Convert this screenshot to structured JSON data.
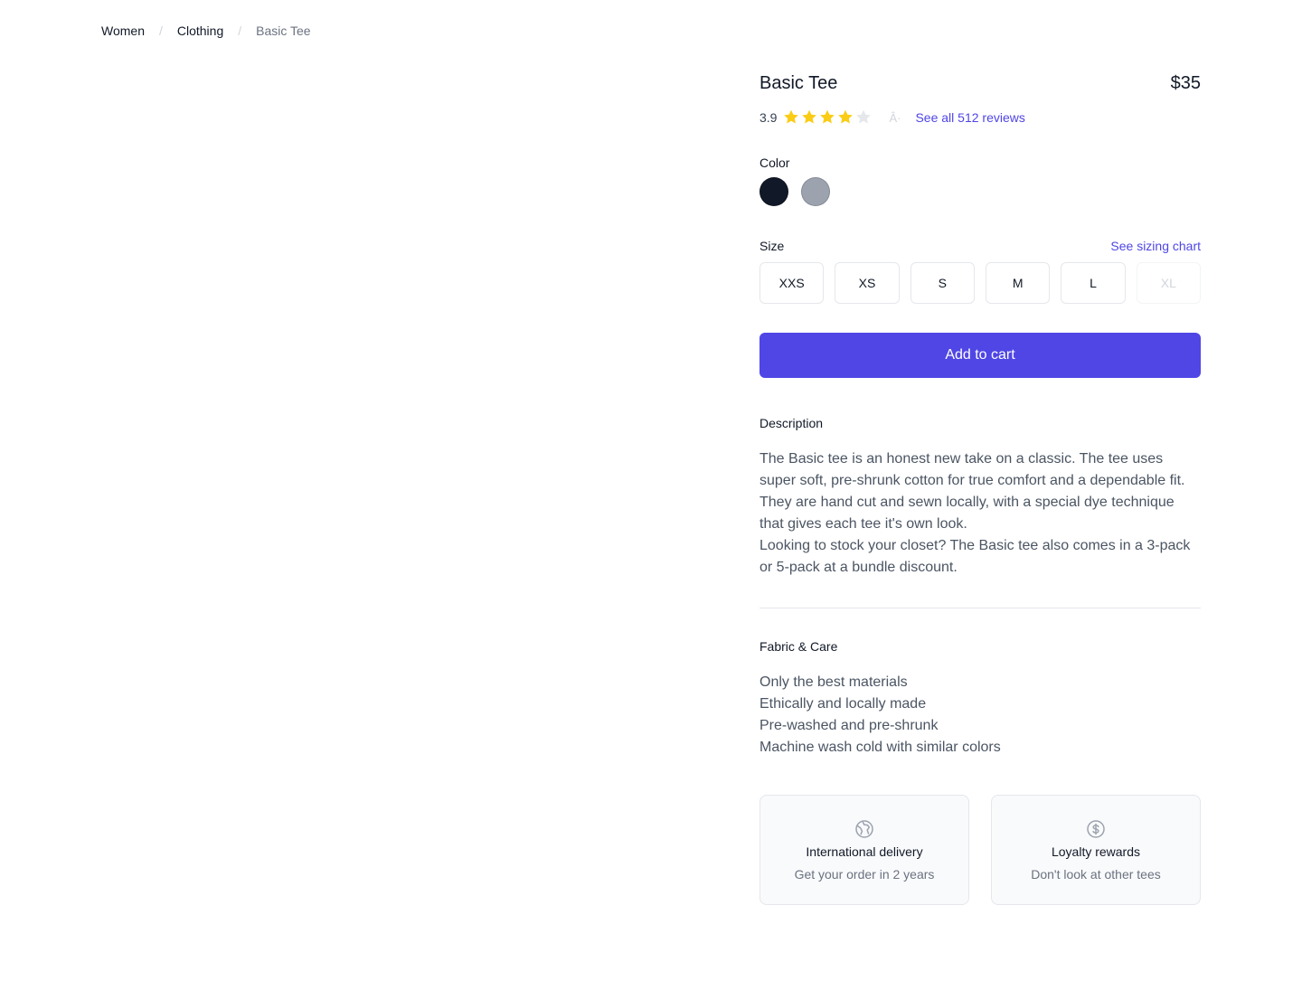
{
  "breadcrumb": {
    "items": [
      "Women",
      "Clothing"
    ],
    "separator": "/",
    "current": "Basic Tee"
  },
  "product": {
    "name": "Basic Tee",
    "price": "$35",
    "rating": {
      "value": "3.9",
      "stars_filled": 4,
      "stars_total": 5,
      "separator_glyph": "Â·",
      "reviews_link": "See all 512 reviews"
    }
  },
  "color": {
    "label": "Color",
    "options": [
      {
        "name": "black-swatch",
        "hex": "#111827"
      },
      {
        "name": "gray-swatch",
        "hex": "#9ca3af"
      }
    ]
  },
  "size": {
    "label": "Size",
    "chart_link": "See sizing chart",
    "options": [
      {
        "label": "XXS",
        "available": true
      },
      {
        "label": "XS",
        "available": true
      },
      {
        "label": "S",
        "available": true
      },
      {
        "label": "M",
        "available": true
      },
      {
        "label": "L",
        "available": true
      },
      {
        "label": "XL",
        "available": false
      }
    ]
  },
  "cart": {
    "button_label": "Add to cart",
    "accent": "#4f46e5"
  },
  "description": {
    "heading": "Description",
    "paragraphs": [
      "The Basic tee is an honest new take on a classic. The tee uses super soft, pre-shrunk cotton for true comfort and a dependable fit. They are hand cut and sewn locally, with a special dye technique that gives each tee it's own look.",
      "Looking to stock your closet? The Basic tee also comes in a 3-pack or 5-pack at a bundle discount."
    ]
  },
  "fabric": {
    "heading": "Fabric & Care",
    "items": [
      "Only the best materials",
      "Ethically and locally made",
      "Pre-washed and pre-shrunk",
      "Machine wash cold with similar colors"
    ]
  },
  "policies": [
    {
      "icon": "globe-icon",
      "title": "International delivery",
      "subtitle": "Get your order in 2 years"
    },
    {
      "icon": "dollar-circle-icon",
      "title": "Loyalty rewards",
      "subtitle": "Don't look at other tees"
    }
  ]
}
